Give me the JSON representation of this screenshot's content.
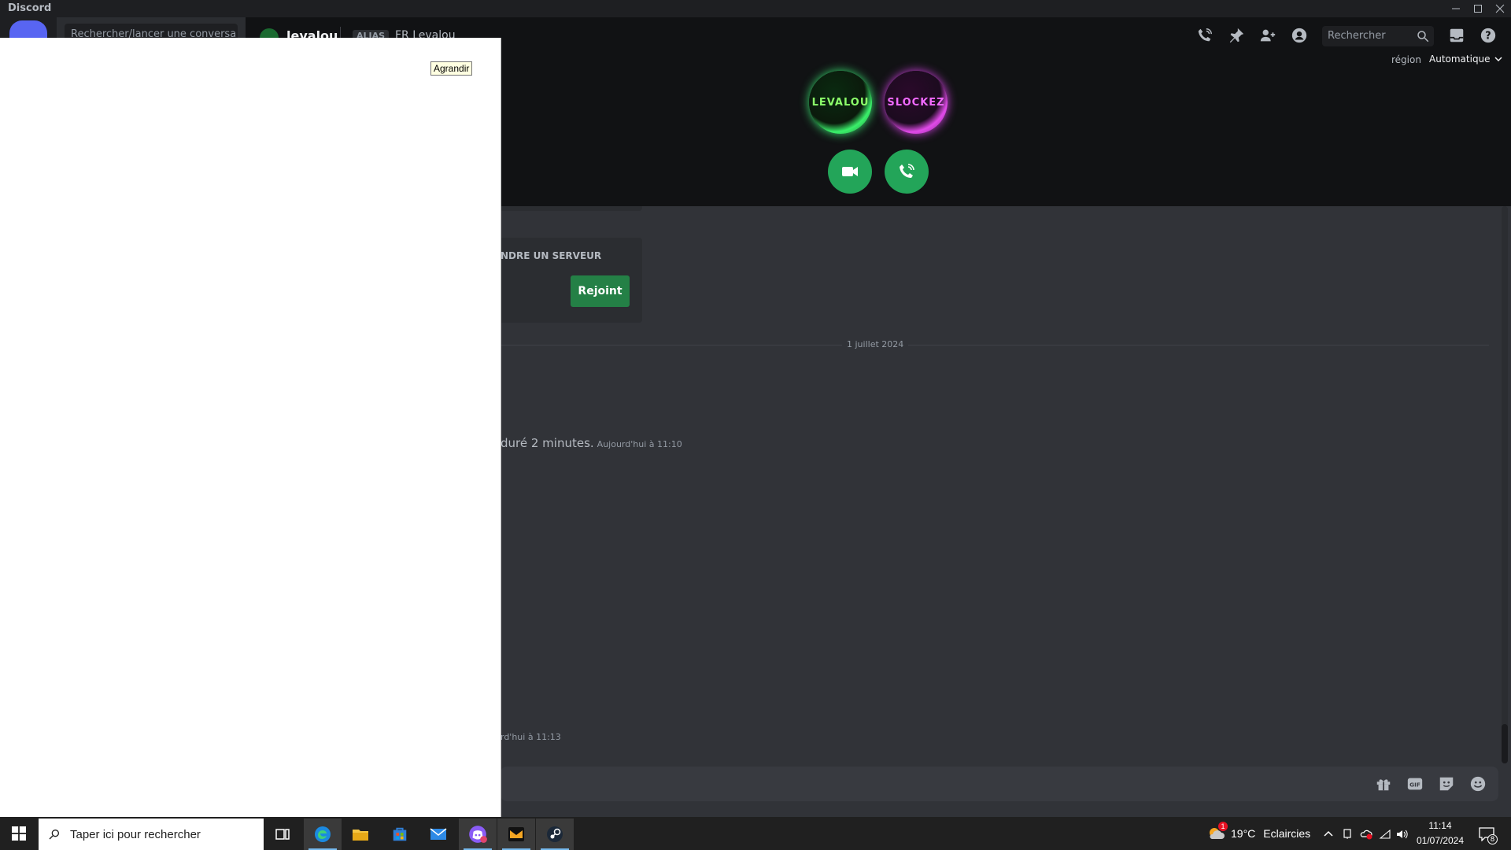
{
  "window": {
    "title": "Discord"
  },
  "dm": {
    "search_placeholder": "Rechercher/lancer une conversa"
  },
  "header": {
    "name": "levalou",
    "alias_tag": "ALIAS",
    "alias_name": "FR Levalou",
    "search_placeholder": "Rechercher",
    "region_label": "région",
    "region_value": "Automatique"
  },
  "call_panel": {
    "avatar1_text": "LEVALOU",
    "avatar2_text": "SLOCKEZ"
  },
  "chat": {
    "invite_title": "NDRE UN SERVEUR",
    "invite_button": "Rejoint",
    "date_divider": "1 juillet 2024",
    "call_message": "duré 2 minutes.",
    "call_timestamp": "Aujourd'hui à 11:10",
    "last_timestamp": "rd'hui à 11:13"
  },
  "tooltip": {
    "text": "Agrandir"
  },
  "taskbar": {
    "search_placeholder": "Taper ici pour rechercher",
    "weather_temp": "19°C",
    "weather_desc": "Eclaircies",
    "weather_badge": "1",
    "time": "11:14",
    "date": "01/07/2024",
    "notif_count": "8"
  },
  "colors": {
    "accent_green": "#23a559",
    "join_button": "#248046",
    "background": "#313338",
    "header_bg": "#111214"
  }
}
